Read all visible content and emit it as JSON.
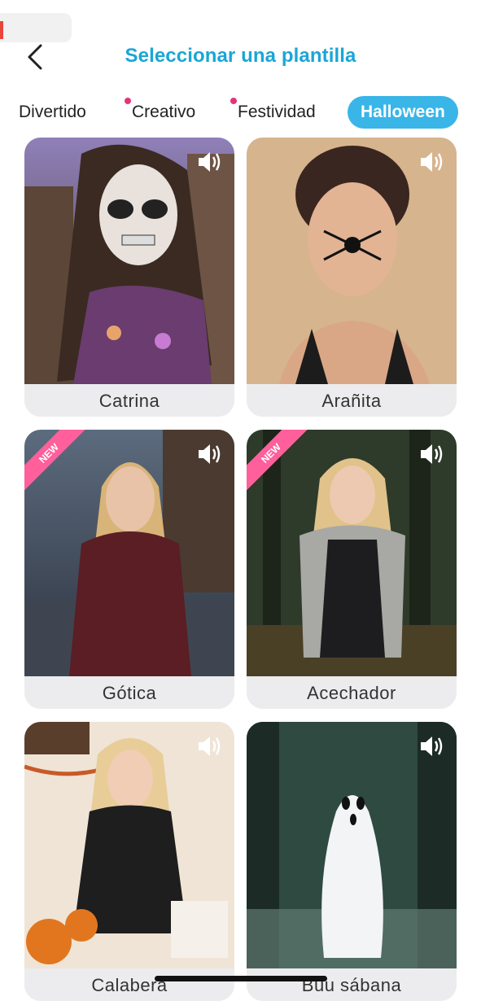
{
  "header": {
    "title": "Seleccionar una plantilla",
    "back_icon": "chevron-left-icon"
  },
  "tabs": [
    {
      "label": "Divertido",
      "dot": false,
      "active": false
    },
    {
      "label": "Creativo",
      "dot": true,
      "active": false
    },
    {
      "label": "Festividad",
      "dot": true,
      "active": false
    },
    {
      "label": "Halloween",
      "dot": false,
      "active": true
    }
  ],
  "colors": {
    "title": "#1aa6d6",
    "active_tab": "#39b5e8",
    "dot": "#e5337a",
    "new_badge": "#ff5f9a"
  },
  "templates": [
    {
      "label": "Catrina",
      "badge": "",
      "icon": "speaker-icon"
    },
    {
      "label": "Arañita",
      "badge": "",
      "icon": "speaker-icon"
    },
    {
      "label": "Gótica",
      "badge": "NEW",
      "icon": "speaker-icon"
    },
    {
      "label": "Acechador",
      "badge": "NEW",
      "icon": "speaker-icon"
    },
    {
      "label": "Calabera",
      "badge": "",
      "icon": "speaker-icon"
    },
    {
      "label": "Buu sábana",
      "badge": "",
      "icon": "speaker-icon"
    }
  ]
}
